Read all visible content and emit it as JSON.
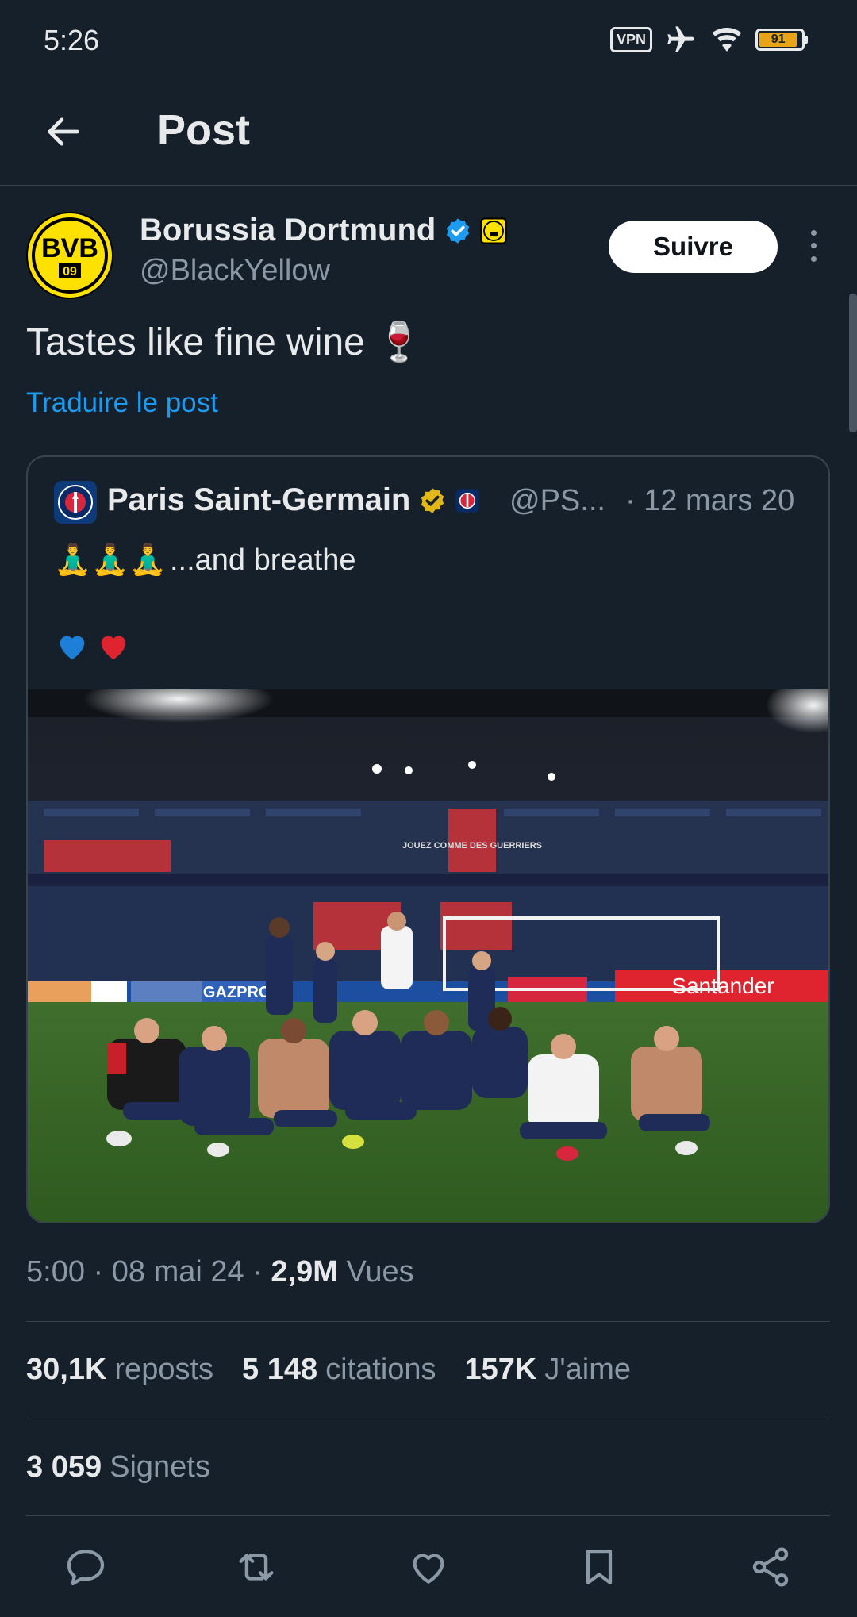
{
  "status_bar": {
    "time": "5:26",
    "vpn_label": "VPN",
    "battery": "91"
  },
  "header": {
    "title": "Post"
  },
  "post": {
    "author_name": "Borussia Dortmund",
    "author_handle": "@BlackYellow",
    "follow_label": "Suivre",
    "text": "Tastes like fine wine 🍷",
    "translate_label": "Traduire le post",
    "avatar_text_top": "BVB",
    "avatar_text_bottom": "09"
  },
  "quoted": {
    "author_name": "Paris Saint-Germain",
    "author_handle": "@PS...",
    "date": "· 12 mars 20",
    "emojis": "🧘‍♂️🧘‍♂️🧘‍♂️",
    "text": "...and breathe",
    "hearts": "💙❤️",
    "image_banner_gazprom": "GAZPROM",
    "image_banner_santander": "Santander",
    "image_banner_stadium": "JOUEZ COMME DES GUERRIERS"
  },
  "meta": {
    "time": "5:00",
    "date": "08 mai 24",
    "views_count": "2,9M",
    "views_label": "Vues"
  },
  "stats": {
    "reposts_count": "30,1K",
    "reposts_label": "reposts",
    "quotes_count": "5 148",
    "quotes_label": "citations",
    "likes_count": "157K",
    "likes_label": "J'aime",
    "bookmarks_count": "3 059",
    "bookmarks_label": "Signets"
  },
  "colors": {
    "background": "#15202b",
    "accent": "#1d9bf0",
    "muted": "#8b98a5",
    "verified_blue": "#1d9bf0",
    "verified_gold": "#e2b719"
  }
}
